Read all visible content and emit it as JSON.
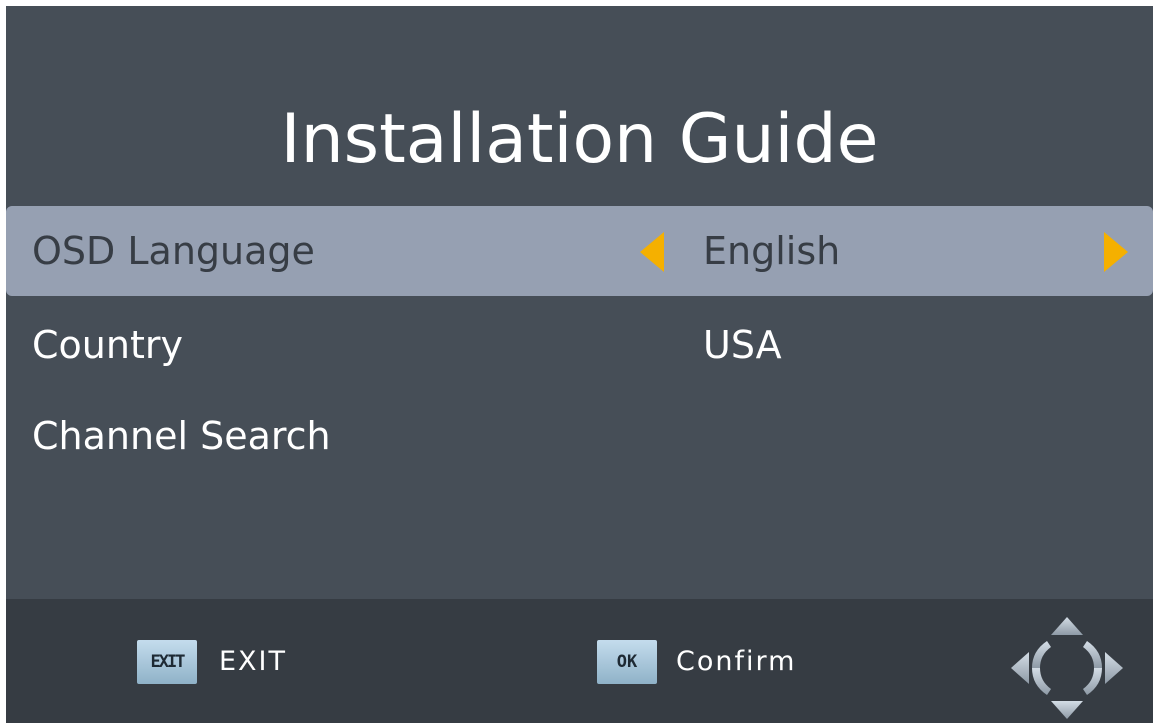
{
  "title": "Installation Guide",
  "menu": {
    "items": [
      {
        "label": "OSD Language",
        "value": "English",
        "selected": true
      },
      {
        "label": "Country",
        "value": "USA",
        "selected": false
      },
      {
        "label": "Channel Search",
        "value": "",
        "selected": false
      }
    ]
  },
  "footer": {
    "exit_key": "EXIT",
    "exit_label": "EXIT",
    "ok_key": "OK",
    "confirm_label": "Confirm",
    "nav_icon": "dpad-navigation-icon"
  },
  "colors": {
    "background": "#464e57",
    "highlight_row": "#96a0b2",
    "footer": "#363c43",
    "arrow_accent": "#f5b000",
    "key_badge": "#a9c6da"
  }
}
